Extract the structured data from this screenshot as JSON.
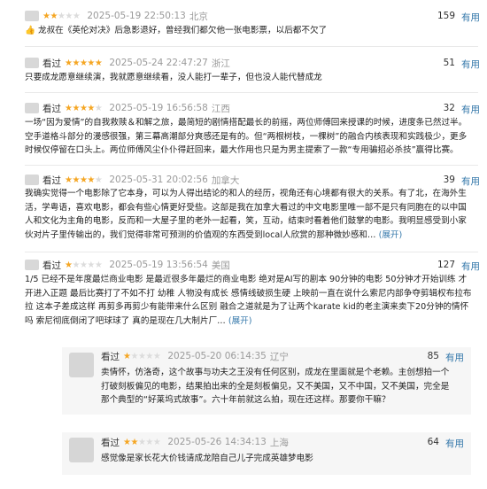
{
  "useful_label": "有用",
  "star_icon": "★",
  "colors": {
    "star": "#f5a623",
    "star_off": "#dcdcdc",
    "link": "#3377aa",
    "meta": "#9a9a9a"
  },
  "reviews": [
    {
      "tag": "",
      "rating": 2,
      "date": "2025-05-19 22:50:13",
      "location": "北京",
      "votes": "159",
      "text": "👍 龙叔在《英伦对决》后急影退好，曾经我们都欠他一张电影票，以后都不欠了"
    },
    {
      "tag": "看过",
      "rating": 5,
      "date": "2025-05-24 22:47:27",
      "location": "浙江",
      "votes": "51",
      "text": "只要成龙愿意继续演，我就愿意继续看，没人能打一辈子，但也没人能代替成龙"
    },
    {
      "tag": "看过",
      "rating": 4,
      "date": "2025-05-19 16:56:58",
      "location": "江西",
      "votes": "32",
      "text": "一场“因为爱情”的自我救赎＆和解之旅，最简短的剧情搭配最长的前摇，两位师傅回来授课的时候，进度条已然过半。空手道格斗部分的漫感很强，第三幕高潮部分爽感还是有的。但“两根树枝，一棵树”的融合内核表现和实践极少，更多时候仅停留在口头上。两位师傅风尘仆仆得赶回来，最大作用也只是为男主提索了一款“专用骗招必杀技”赢得比赛。"
    },
    {
      "tag": "看过",
      "rating": 4,
      "date": "2025-05-31 20:02:56",
      "location": "加拿大",
      "votes": "39",
      "text": "我确实觉得一个电影除了它本身，可以为人得出结论的和人的经历，视角还有心境都有很大的关系。有了北，在海外生活，学粤语，喜欢电影，都会有些心情更好受些。这部是我在加拿大看过的中文电影里唯一部不是只有同胞在的以中国人和文化为主角的电影，反而和一大屋子里的老外一起看，笑，互动，结束时看着他们鼓掌的电影。我明显感受到小家伙对片子里传输出的，我们觉得非常可预测的价值观的东西受到local人欣赏的那种微妙感和…",
      "expand": "(展开)"
    },
    {
      "tag": "看过",
      "rating": 1,
      "date": "2025-05-19 13:56:54",
      "location": "美国",
      "votes": "127",
      "text": "1/5 已经不是年度最烂商业电影 是最近很多年最烂的商业电影 绝对是AI写的剧本 90分钟的电影 50分钟才开始训练 才开进入正题 最后比赛打了不如不打 幼稚 人物没有成长 感情线破损生硬 上映前一直在说什么索尼内部争夺剪辑权布拉布拉 这本子差成这样 再剪多再剪少有能带来什么区别 融合之道就是为了让两个karate kid的老主演来卖下20分钟的情怀吗 索尼彻底倒闭了吧球球了 真的是现在几大制片厂…",
      "expand": "(展开)"
    }
  ],
  "replies": [
    {
      "tag": "看过",
      "rating": 1,
      "date": "2025-05-20 06:14:35",
      "location": "辽宁",
      "votes": "85",
      "text": "卖情怀，仿洛奇，这个故事与功夫之王没有任何区别，成龙在里面就是个老赖。主创想拍一个打破刻板偏见的电影，结果拍出来的全是刻板偏见，又不美国，又不中国，又不美国，完全是那个典型的“好莱坞式故事”。六十年前就这么拍，现在还这样。那要你干嘛？"
    },
    {
      "tag": "看过",
      "rating": 2,
      "date": "2025-05-26 14:34:13",
      "location": "上海",
      "votes": "64",
      "text": "感觉像是家长花大价钱请成龙陪自己儿子完成英雄梦电影"
    }
  ]
}
